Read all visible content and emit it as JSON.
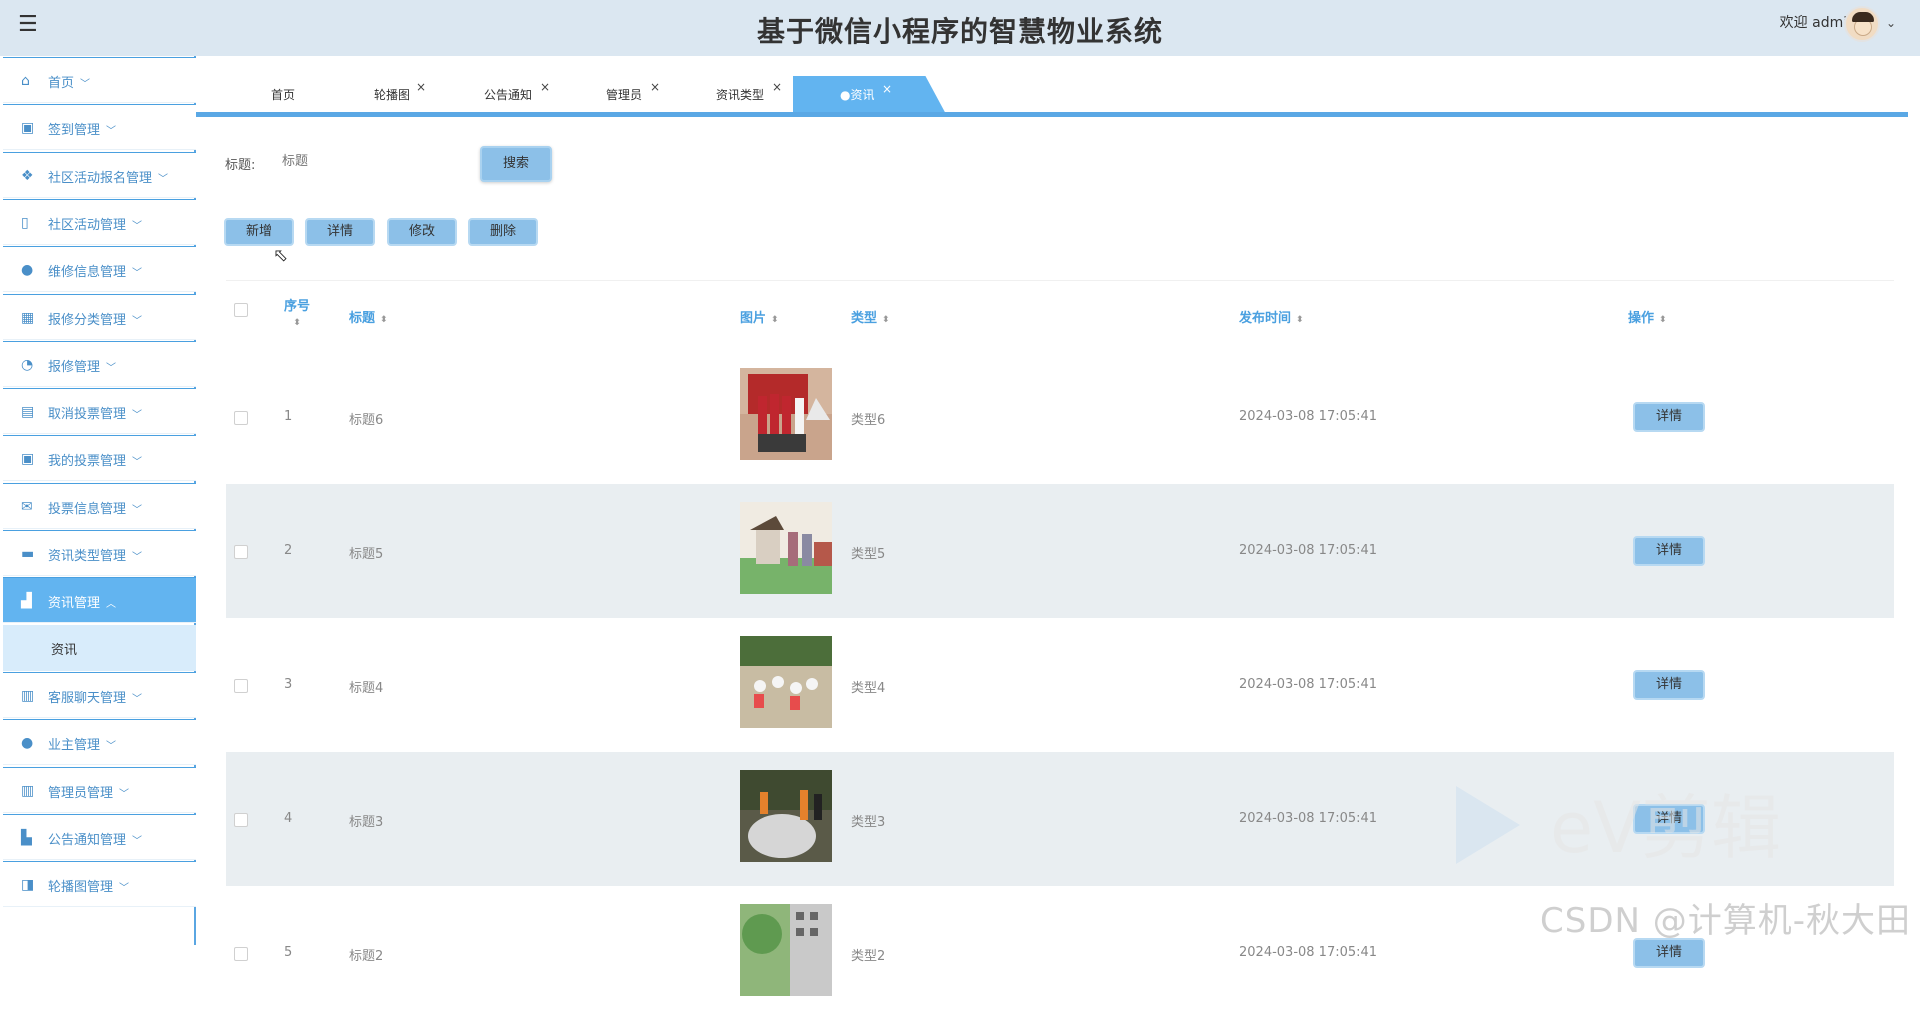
{
  "header": {
    "title": "基于微信小程序的智慧物业系统",
    "welcome": "欢迎 admin"
  },
  "sidebar": {
    "items": [
      {
        "label": "首页",
        "icon": "home-icon"
      },
      {
        "label": "签到管理",
        "icon": "picture-icon"
      },
      {
        "label": "社区活动报名管理",
        "icon": "apps-icon"
      },
      {
        "label": "社区活动管理",
        "icon": "panel-icon"
      },
      {
        "label": "维修信息管理",
        "icon": "circle-icon"
      },
      {
        "label": "报修分类管理",
        "icon": "grid-icon"
      },
      {
        "label": "报修管理",
        "icon": "gauge-icon"
      },
      {
        "label": "取消投票管理",
        "icon": "calculator-icon"
      },
      {
        "label": "我的投票管理",
        "icon": "picture-icon"
      },
      {
        "label": "投票信息管理",
        "icon": "mail-icon"
      },
      {
        "label": "资讯类型管理",
        "icon": "ticket-icon"
      },
      {
        "label": "资讯管理",
        "icon": "news-icon"
      },
      {
        "label": "客服聊天管理",
        "icon": "briefcase-icon"
      },
      {
        "label": "业主管理",
        "icon": "drop-icon"
      },
      {
        "label": "管理员管理",
        "icon": "columns-icon"
      },
      {
        "label": "公告通知管理",
        "icon": "chart-icon"
      },
      {
        "label": "轮播图管理",
        "icon": "toggle-icon"
      }
    ],
    "sub_item": "资讯"
  },
  "tabs": [
    {
      "label": "首页",
      "closable": false
    },
    {
      "label": "轮播图",
      "closable": true
    },
    {
      "label": "公告通知",
      "closable": true
    },
    {
      "label": "管理员",
      "closable": true
    },
    {
      "label": "资讯类型",
      "closable": true
    },
    {
      "label": "●资讯",
      "closable": true
    }
  ],
  "search": {
    "label": "标题:",
    "placeholder": "标题",
    "button": "搜索"
  },
  "actions": {
    "add": "新增",
    "detail": "详情",
    "edit": "修改",
    "delete": "删除"
  },
  "table": {
    "columns": [
      "序号",
      "标题",
      "图片",
      "类型",
      "发布时间",
      "操作"
    ],
    "rows": [
      {
        "index": "1",
        "title": "标题6",
        "type": "类型6",
        "time": "2024-03-08 17:05:41",
        "action": "详情"
      },
      {
        "index": "2",
        "title": "标题5",
        "type": "类型5",
        "time": "2024-03-08 17:05:41",
        "action": "详情"
      },
      {
        "index": "3",
        "title": "标题4",
        "type": "类型4",
        "time": "2024-03-08 17:05:41",
        "action": "详情"
      },
      {
        "index": "4",
        "title": "标题3",
        "type": "类型3",
        "time": "2024-03-08 17:05:41",
        "action": "详情"
      },
      {
        "index": "5",
        "title": "标题2",
        "type": "类型2",
        "time": "2024-03-08 17:05:41",
        "action": "详情"
      }
    ]
  },
  "watermark": {
    "ev": "eV剪辑",
    "csdn": "CSDN @计算机-秋大田"
  },
  "colors": {
    "accent": "#62b4f0",
    "header_bg": "#dbe7f1",
    "button": "#8cc0e8"
  }
}
